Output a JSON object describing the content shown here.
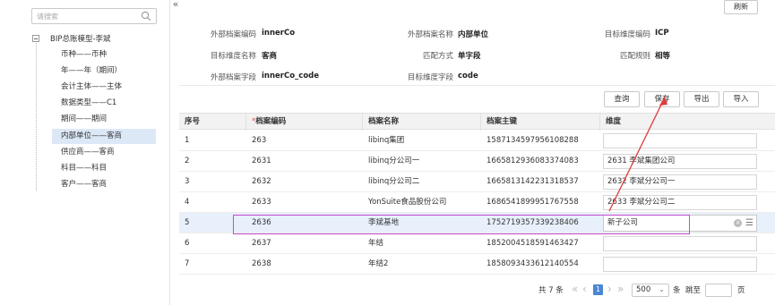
{
  "sidebar": {
    "search_placeholder": "请搜索",
    "root_label": "BIP总账模型-李斌",
    "items": [
      {
        "label": "币种——币种"
      },
      {
        "label": "年——年（期间）"
      },
      {
        "label": "会计主体——主体"
      },
      {
        "label": "数据类型——C1"
      },
      {
        "label": "期间——期间"
      },
      {
        "label": "内部单位——客商"
      },
      {
        "label": "供应商——客商"
      },
      {
        "label": "科目——科目"
      },
      {
        "label": "客户——客商"
      }
    ]
  },
  "toolbar": {
    "refresh_label": "刷新"
  },
  "info": {
    "ext_code_label": "外部档案编码",
    "ext_code_value": "innerCo",
    "ext_name_label": "外部档案名称",
    "ext_name_value": "内部单位",
    "target_code_label": "目标维度编码",
    "target_code_value": "ICP",
    "target_name_label": "目标维度名称",
    "target_name_value": "客商",
    "match_mode_label": "匹配方式",
    "match_mode_value": "单字段",
    "match_rule_label": "匹配规则",
    "match_rule_value": "相等",
    "ext_field_label": "外部档案字段",
    "ext_field_value": "innerCo_code",
    "target_field_label": "目标维度字段",
    "target_field_value": "code"
  },
  "actions": {
    "query": "查询",
    "save": "保存",
    "export": "导出",
    "import": "导入"
  },
  "table": {
    "headers": {
      "no": "序号",
      "code": "档案编码",
      "name": "档案名称",
      "key": "档案主键",
      "dim": "维度"
    },
    "required_mark": "*",
    "rows": [
      {
        "no": "1",
        "code": "263",
        "name": "libinq集团",
        "key": "1587134597956108288",
        "dim": ""
      },
      {
        "no": "2",
        "code": "2631",
        "name": "libinq分公司一",
        "key": "1665812936083374083",
        "dim": "2631 李斌集团公司"
      },
      {
        "no": "3",
        "code": "2632",
        "name": "libinq分公司二",
        "key": "1665813142231318537",
        "dim": "2632 李斌分公司一"
      },
      {
        "no": "4",
        "code": "2633",
        "name": "YonSuite食品股份公司",
        "key": "1686541899951767558",
        "dim": "2633 李斌分公司二"
      },
      {
        "no": "5",
        "code": "2636",
        "name": "李斌基地",
        "key": "1752719357339238406",
        "dim": "新子公司"
      },
      {
        "no": "6",
        "code": "2637",
        "name": "年结",
        "key": "1852004518591463427",
        "dim": ""
      },
      {
        "no": "7",
        "code": "2638",
        "name": "年结2",
        "key": "1858093433612140554",
        "dim": ""
      }
    ]
  },
  "pagination": {
    "total": "共 7 条",
    "current": "1",
    "page_size": "500",
    "per_page": "条",
    "jump": "跳至",
    "page": "页"
  },
  "colors": {
    "accent": "#4b87d3",
    "highlight": "#c64bd0",
    "arrow": "#e03a3a"
  }
}
